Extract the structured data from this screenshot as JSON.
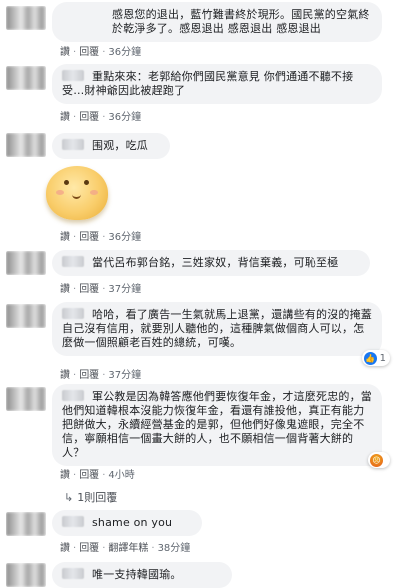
{
  "comments": [
    {
      "text": "感恩您的退出，藍竹難書終於現形。國民黨的空氣終於乾淨多了。感恩退出 感恩退出 感恩退出",
      "like": "讚",
      "reply": "回覆",
      "time": "36分鐘"
    },
    {
      "text": "重點來來：老郭給你們國民黨意見 你們通通不聽不接受…財神爺因此被趕跑了",
      "like": "讚",
      "reply": "回覆",
      "time": "36分鐘"
    },
    {
      "text": "围观，吃瓜",
      "like": "讚",
      "reply": "回覆",
      "time": "36分鐘"
    },
    {
      "text": "當代呂布郭台銘，三姓家奴，背信棄義，可恥至極",
      "like": "讚",
      "reply": "回覆",
      "time": "37分鐘"
    },
    {
      "text": "哈哈，看了廣告一生氣就馬上退黨，還講些有的沒的掩蓋自己沒有信用，就要別人聽他的，這種脾氣做個商人可以，怎麼做一個照顧老百姓的總統，可嘆。",
      "like": "讚",
      "reply": "回覆",
      "time": "37分鐘",
      "reaction_count": "1"
    },
    {
      "text": "軍公教是因為韓答應他們要恢復年金，才這麼死忠的，當他們知道韓根本沒能力恢復年金，看還有誰投他，真正有能力把餅做大，永續經營基金的是郭，但他們好像鬼遮眼，完全不信，寧願相信一個畫大餅的人，也不願相信一個背著大餅的人？",
      "like": "讚",
      "reply": "回覆",
      "time": "4小時",
      "replies_link": "1則回覆"
    },
    {
      "text": "shame on you",
      "like": "讚",
      "reply": "回覆",
      "translate": "翻譯年糕",
      "time": "38分鐘"
    },
    {
      "text": "唯一支持韓國瑜。",
      "like": "",
      "reply": "",
      "time": ""
    }
  ]
}
